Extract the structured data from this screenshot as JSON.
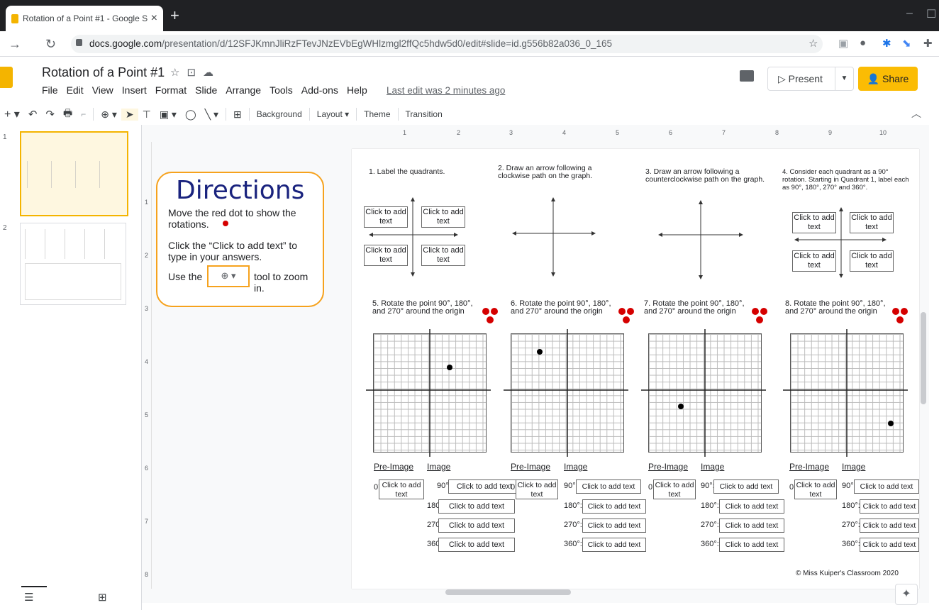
{
  "browser": {
    "tab_title": "Rotation of a Point #1 - Google S",
    "close": "×",
    "new_tab": "+",
    "url_host": "docs.google.com",
    "url_path": "/presentation/d/12SFJKmnJliRzFTevJNzEVbEgWHlzmgl2ffQc5hdw5d0/edit#slide=id.g556b82a036_0_165"
  },
  "app": {
    "title": "Rotation of a Point #1",
    "menu": [
      "File",
      "Edit",
      "View",
      "Insert",
      "Format",
      "Slide",
      "Arrange",
      "Tools",
      "Add-ons",
      "Help"
    ],
    "last_edit": "Last edit was 2 minutes ago",
    "present_label": "Present",
    "share_label": "Share",
    "toolbar": {
      "background": "Background",
      "layout": "Layout",
      "theme": "Theme",
      "transition": "Transition"
    }
  },
  "filmstrip": {
    "slide_numbers": [
      "1",
      "2"
    ]
  },
  "ruler": {
    "top": [
      "1",
      "2",
      "3",
      "4",
      "5",
      "6",
      "7",
      "8",
      "9",
      "10"
    ],
    "left": [
      "1",
      "2",
      "3",
      "4",
      "5",
      "6",
      "7",
      "8"
    ]
  },
  "directions": {
    "heading": "Directions",
    "line1": "Move the red dot to show the rotations.",
    "line2": "Click the “Click to add text” to type in your answers.",
    "line3a": "Use the",
    "line3b": "tool to zoom in."
  },
  "slide": {
    "q1": "1. Label the quadrants.",
    "q2": "2. Draw an arrow following a clockwise path on the graph.",
    "q3": "3. Draw an arrow following a counterclockwise path on the graph.",
    "q4": "4. Consider each quadrant as a 90° rotation. Starting in Quadrant 1, label each as 90°, 180°, 270° and 360°.",
    "q5": "5. Rotate the point 90°, 180°, and 270° around the origin",
    "q6": "6. Rotate the point 90°, 180°, and 270° around the origin",
    "q7": "7. Rotate the point 90°, 180°, and 270° around the origin",
    "q8": "8. Rotate the point 90°, 180°, and 270° around the origin",
    "click_to_add": "Click to add text",
    "pre_image": "Pre-Image",
    "image": "Image",
    "deg0": "0°:",
    "deg90": "90°:",
    "deg180": "180°:",
    "deg270": "270°:",
    "deg360": "360°:",
    "copyright": "© Miss Kuiper's Classroom 2020"
  }
}
